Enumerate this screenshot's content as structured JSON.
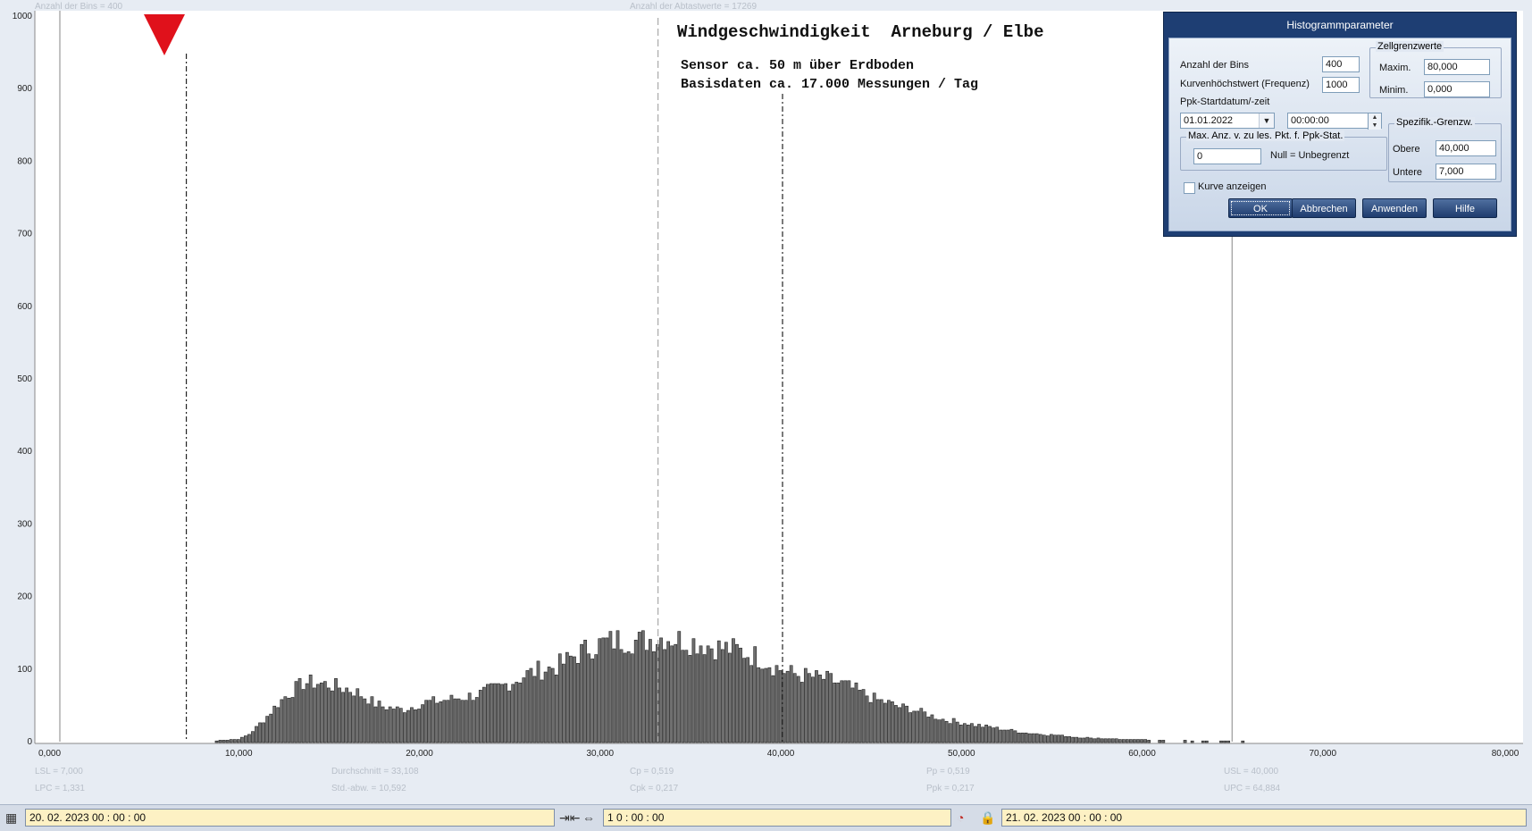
{
  "chart_data": {
    "type": "bar",
    "title": "Windgeschwindigkeit  Arneburg / Elbe",
    "subtitle_lines": [
      "Sensor ca. 50 m über Erdboden",
      "Basisdaten ca. 17.000 Messungen / Tag"
    ],
    "header_left": "Anzahl der Bins =  400",
    "header_center": "Anzahl der Abtastwerte = 17269",
    "xlim": [
      0,
      80
    ],
    "ylim": [
      0,
      1000
    ],
    "x_ticks": [
      "0,000",
      "10,000",
      "20,000",
      "30,000",
      "40,000",
      "50,000",
      "60,000",
      "70,000",
      "80,000"
    ],
    "y_ticks": [
      "0",
      "100",
      "200",
      "300",
      "400",
      "500",
      "600",
      "700",
      "800",
      "900",
      "1000"
    ],
    "bin_width": 0.2,
    "reference_lines": {
      "lsl": 7.0,
      "mean": 33.108,
      "usl": 40.0,
      "upc": 64.884,
      "first_bin": 0.0
    },
    "stats": [
      [
        "LSL = 7,000",
        "LPC = 1,331"
      ],
      [
        "Durchschnitt  = 33,108",
        "Std.-abw.  = 10,592"
      ],
      [
        "Cp  = 0,519",
        "Cpk = 0,217"
      ],
      [
        "Pp  = 0,519",
        "Ppk = 0,217"
      ],
      [
        "USL = 40,000",
        "UPC = 64,884"
      ]
    ],
    "series_values": [
      0,
      0,
      0,
      0,
      0,
      0,
      0,
      0,
      0,
      0,
      0,
      0,
      0,
      0,
      0,
      0,
      0,
      0,
      0,
      0,
      0,
      0,
      0,
      0,
      0,
      0,
      0,
      0,
      0,
      0,
      0,
      0,
      0,
      0,
      0,
      0,
      0,
      0,
      0,
      0,
      0,
      0,
      0,
      0,
      0,
      0,
      0,
      0,
      0,
      0,
      0,
      0,
      0,
      0,
      0,
      0,
      0,
      0,
      0,
      0,
      0,
      0,
      0,
      0,
      0,
      0,
      0,
      0,
      0,
      0,
      0,
      0,
      0,
      0,
      0,
      0,
      0,
      0,
      0,
      0,
      0,
      0,
      0,
      0,
      0,
      0,
      0,
      0,
      0,
      0,
      0,
      0,
      0,
      0,
      0,
      0,
      0,
      0,
      0,
      0,
      0,
      0,
      0,
      0,
      0,
      0,
      0,
      0,
      0,
      0,
      0,
      0,
      0,
      0,
      0,
      0,
      0,
      0,
      0,
      0,
      0,
      0,
      0,
      0,
      0,
      0,
      0,
      0,
      0,
      0,
      0,
      0,
      0,
      0,
      0,
      0,
      0,
      0,
      0,
      0,
      0,
      0,
      0,
      0,
      0,
      0,
      0,
      0,
      0,
      0,
      0,
      0,
      0,
      0,
      0,
      0,
      0,
      0,
      0,
      0,
      0,
      0,
      0,
      0,
      0,
      0,
      0,
      0,
      0,
      0,
      0,
      0,
      0,
      0,
      0,
      0,
      0,
      0,
      0,
      0,
      0,
      0,
      0,
      0,
      0,
      0,
      0,
      0,
      0,
      0,
      0,
      0,
      0,
      0,
      0,
      0,
      0,
      0,
      0,
      0,
      0,
      0,
      0,
      0,
      0,
      0,
      0,
      0,
      0,
      0,
      0,
      0,
      0,
      0,
      0,
      0,
      0,
      0,
      0,
      0,
      0,
      0,
      0,
      0,
      0,
      0,
      0,
      0,
      0,
      0,
      0,
      0,
      0,
      0,
      0,
      0,
      0,
      0,
      0,
      0,
      0,
      0,
      0,
      0,
      0,
      0,
      0,
      0,
      0,
      0,
      0,
      0,
      0,
      0,
      0,
      0,
      0,
      0,
      0,
      0,
      0,
      0,
      0,
      0,
      0,
      0,
      0,
      0,
      0,
      0,
      0,
      0,
      0,
      0,
      0,
      0,
      0,
      0,
      0,
      0,
      0,
      0,
      0,
      0,
      0,
      0,
      0,
      0,
      0,
      0,
      0,
      0,
      0,
      0,
      0,
      0,
      0,
      0,
      0,
      0,
      0,
      0,
      0,
      0,
      0,
      0,
      0,
      0,
      0,
      0,
      0,
      0,
      0,
      0,
      0,
      0,
      0,
      0,
      0,
      0,
      0,
      0,
      0,
      0,
      0,
      0,
      0,
      0,
      0,
      0,
      0,
      0,
      0,
      0,
      0,
      0,
      0,
      0,
      0,
      0,
      0,
      0,
      0,
      0,
      0,
      0,
      0,
      0,
      0,
      0,
      0,
      0,
      0,
      0,
      0,
      0,
      0,
      0,
      0,
      0,
      0,
      0,
      0,
      0,
      0,
      0,
      0,
      0,
      0,
      0,
      0,
      0,
      0,
      0,
      0,
      0,
      0
    ],
    "series_profile": [
      [
        8.5,
        0
      ],
      [
        9.0,
        2
      ],
      [
        9.5,
        3
      ],
      [
        10.0,
        4
      ],
      [
        10.5,
        10
      ],
      [
        11.0,
        22
      ],
      [
        11.5,
        35
      ],
      [
        12.0,
        50
      ],
      [
        12.5,
        62
      ],
      [
        13.0,
        72
      ],
      [
        13.5,
        80
      ],
      [
        14.0,
        82
      ],
      [
        14.5,
        80
      ],
      [
        15.0,
        78
      ],
      [
        15.5,
        75
      ],
      [
        16.0,
        72
      ],
      [
        16.5,
        68
      ],
      [
        17.0,
        60
      ],
      [
        17.5,
        52
      ],
      [
        18.0,
        48
      ],
      [
        18.5,
        46
      ],
      [
        19.0,
        44
      ],
      [
        19.5,
        48
      ],
      [
        20.0,
        52
      ],
      [
        20.5,
        55
      ],
      [
        21.0,
        56
      ],
      [
        21.5,
        58
      ],
      [
        22.0,
        60
      ],
      [
        22.5,
        62
      ],
      [
        23.0,
        64
      ],
      [
        23.5,
        68
      ],
      [
        24.0,
        72
      ],
      [
        24.5,
        76
      ],
      [
        25.0,
        82
      ],
      [
        25.5,
        88
      ],
      [
        26.0,
        94
      ],
      [
        26.5,
        98
      ],
      [
        27.0,
        100
      ],
      [
        27.5,
        104
      ],
      [
        28.0,
        110
      ],
      [
        28.5,
        118
      ],
      [
        29.0,
        125
      ],
      [
        29.5,
        132
      ],
      [
        30.0,
        135
      ],
      [
        30.5,
        138
      ],
      [
        31.0,
        140
      ],
      [
        31.5,
        140
      ],
      [
        32.0,
        138
      ],
      [
        32.5,
        140
      ],
      [
        33.0,
        142
      ],
      [
        33.5,
        145
      ],
      [
        34.0,
        142
      ],
      [
        34.5,
        140
      ],
      [
        35.0,
        138
      ],
      [
        35.5,
        136
      ],
      [
        36.0,
        132
      ],
      [
        36.5,
        130
      ],
      [
        37.0,
        128
      ],
      [
        37.5,
        126
      ],
      [
        38.0,
        122
      ],
      [
        38.5,
        118
      ],
      [
        39.0,
        112
      ],
      [
        39.5,
        105
      ],
      [
        40.0,
        98
      ],
      [
        40.5,
        94
      ],
      [
        41.0,
        92
      ],
      [
        41.5,
        90
      ],
      [
        42.0,
        88
      ],
      [
        42.5,
        86
      ],
      [
        43.0,
        82
      ],
      [
        43.5,
        78
      ],
      [
        44.0,
        72
      ],
      [
        44.5,
        66
      ],
      [
        45.0,
        60
      ],
      [
        45.5,
        56
      ],
      [
        46.0,
        52
      ],
      [
        46.5,
        48
      ],
      [
        47.0,
        46
      ],
      [
        47.5,
        42
      ],
      [
        48.0,
        38
      ],
      [
        48.5,
        34
      ],
      [
        49.0,
        30
      ],
      [
        49.5,
        28
      ],
      [
        50.0,
        26
      ],
      [
        50.5,
        24
      ],
      [
        51.0,
        22
      ],
      [
        51.5,
        20
      ],
      [
        52.0,
        18
      ],
      [
        52.5,
        16
      ],
      [
        53.0,
        14
      ],
      [
        53.5,
        12
      ],
      [
        54.0,
        11
      ],
      [
        54.5,
        10
      ],
      [
        55.0,
        9
      ],
      [
        55.5,
        8
      ],
      [
        56.0,
        7
      ],
      [
        56.5,
        6
      ],
      [
        57.0,
        5
      ],
      [
        57.5,
        5
      ],
      [
        58.0,
        4
      ],
      [
        58.5,
        4
      ],
      [
        59.0,
        3
      ],
      [
        60.0,
        3
      ],
      [
        61.0,
        2
      ],
      [
        62.0,
        2
      ],
      [
        63.0,
        1
      ],
      [
        64.0,
        1
      ],
      [
        65.0,
        0.5
      ],
      [
        66.0,
        0.5
      ],
      [
        67.0,
        0.3
      ],
      [
        70.0,
        0.2
      ],
      [
        73.0,
        0.1
      ],
      [
        77.0,
        0
      ]
    ]
  },
  "dialog": {
    "title": "Histogrammparameter",
    "bins_label": "Anzahl der Bins",
    "bins_value": "400",
    "curve_max_label": "Kurvenhöchstwert (Frequenz)",
    "curve_max_value": "1000",
    "ppk_label": "Ppk-Startdatum/-zeit",
    "ppk_date": "01.01.2022",
    "ppk_time": "00:00:00",
    "group_zell": "Zellgrenzwerte",
    "maxim_label": "Maxim.",
    "maxim_value": "80,000",
    "minim_label": "Minim.",
    "minim_value": "0,000",
    "group_maxanz": "Max. Anz. v. zu les. Pkt. f. Ppk-Stat.",
    "maxanz_value": "0",
    "null_hint": "Null = Unbegrenzt",
    "group_spezifik": "Spezifik.-Grenzw.",
    "obere_label": "Obere",
    "obere_value": "40,000",
    "untere_label": "Untere",
    "untere_value": "7,000",
    "kurve_label": "Kurve anzeigen",
    "kurve_checked": false,
    "btn_ok": "OK",
    "btn_abbrechen": "Abbrechen",
    "btn_anwenden": "Anwenden",
    "btn_hilfe": "Hilfe"
  },
  "bottombar": {
    "start": "20. 02. 2023   00 : 00 : 00",
    "interval": "1  0 : 00 : 00",
    "end": "21. 02. 2023   00 : 00 : 00",
    "icons": [
      "calendar-icon",
      "collapse-arrows-icon",
      "expand-arrows-icon",
      "clock-icon",
      "lock-icon"
    ]
  },
  "colors": {
    "bar_fill": "#6f6f6f",
    "marker": "#e0111b",
    "accent": "#fdf1c4"
  }
}
